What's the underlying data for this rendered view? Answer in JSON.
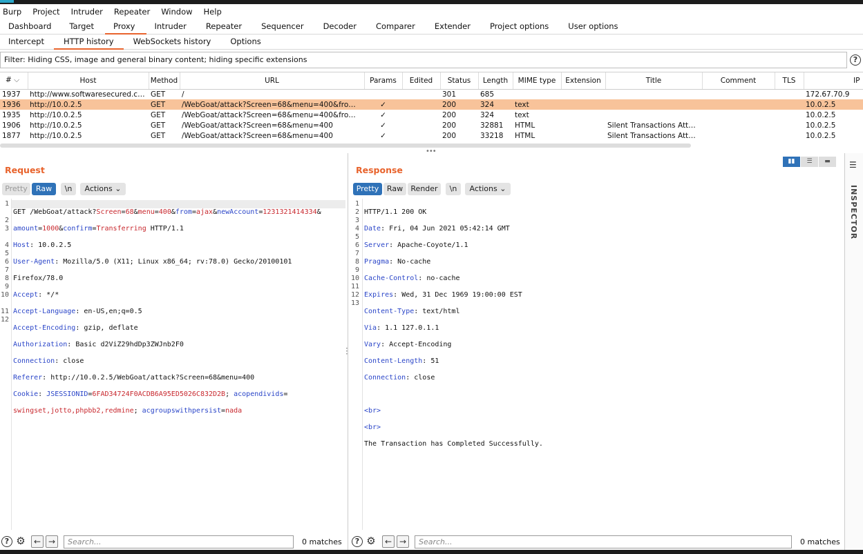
{
  "menubar": [
    "Burp",
    "Project",
    "Intruder",
    "Repeater",
    "Window",
    "Help"
  ],
  "main_tabs": [
    "Dashboard",
    "Target",
    "Proxy",
    "Intruder",
    "Repeater",
    "Sequencer",
    "Decoder",
    "Comparer",
    "Extender",
    "Project options",
    "User options"
  ],
  "main_tab_active": "Proxy",
  "sub_tabs": [
    "Intercept",
    "HTTP history",
    "WebSockets history",
    "Options"
  ],
  "sub_tab_active": "HTTP history",
  "filter_text": "Filter: Hiding CSS, image and general binary content;  hiding specific extensions",
  "help_label": "?",
  "table": {
    "columns": [
      "#",
      "Host",
      "Method",
      "URL",
      "Params",
      "Edited",
      "Status",
      "Length",
      "MIME type",
      "Extension",
      "Title",
      "Comment",
      "TLS",
      "IP"
    ],
    "rows": [
      {
        "num": "1937",
        "host": "http://www.softwaresecured.com",
        "method": "GET",
        "url": "/",
        "params": "",
        "edited": "",
        "status": "301",
        "length": "685",
        "mime": "",
        "ext": "",
        "title": "",
        "comment": "",
        "tls": "",
        "ip": "172.67.70.9",
        "selected": false
      },
      {
        "num": "1936",
        "host": "http://10.0.2.5",
        "method": "GET",
        "url": "/WebGoat/attack?Screen=68&menu=400&from=...",
        "params": "✓",
        "edited": "",
        "status": "200",
        "length": "324",
        "mime": "text",
        "ext": "",
        "title": "",
        "comment": "",
        "tls": "",
        "ip": "10.0.2.5",
        "selected": true
      },
      {
        "num": "1935",
        "host": "http://10.0.2.5",
        "method": "GET",
        "url": "/WebGoat/attack?Screen=68&menu=400&from=...",
        "params": "✓",
        "edited": "",
        "status": "200",
        "length": "324",
        "mime": "text",
        "ext": "",
        "title": "",
        "comment": "",
        "tls": "",
        "ip": "10.0.2.5",
        "selected": false
      },
      {
        "num": "1906",
        "host": "http://10.0.2.5",
        "method": "GET",
        "url": "/WebGoat/attack?Screen=68&menu=400",
        "params": "✓",
        "edited": "",
        "status": "200",
        "length": "32881",
        "mime": "HTML",
        "ext": "",
        "title": "Silent Transactions Attacks",
        "comment": "",
        "tls": "",
        "ip": "10.0.2.5",
        "selected": false
      },
      {
        "num": "1877",
        "host": "http://10.0.2.5",
        "method": "GET",
        "url": "/WebGoat/attack?Screen=68&menu=400",
        "params": "✓",
        "edited": "",
        "status": "200",
        "length": "33218",
        "mime": "HTML",
        "ext": "",
        "title": "Silent Transactions Attacks",
        "comment": "",
        "tls": "",
        "ip": "10.0.2.5",
        "selected": false
      }
    ]
  },
  "request": {
    "title": "Request",
    "buttons": {
      "pretty": "Pretty",
      "raw": "Raw",
      "newline": "\\n",
      "actions": "Actions"
    },
    "line_numbers": [
      "1",
      "",
      "2",
      "3",
      "",
      "4",
      "5",
      "6",
      "7",
      "8",
      "9",
      "10",
      "",
      "11",
      "12"
    ],
    "lines": {
      "l1": [
        "GET /WebGoat/attack?",
        "Screen",
        "=",
        "68",
        "&",
        "menu",
        "=",
        "400",
        "&",
        "from",
        "=",
        "ajax",
        "&",
        "newAccount",
        "=",
        "1231321414334",
        "&"
      ],
      "l1b": [
        "amount",
        "=",
        "1000",
        "&",
        "confirm",
        "=",
        "Transferring",
        " HTTP/1.1"
      ],
      "l2": [
        "Host",
        ": 10.0.2.5"
      ],
      "l3": [
        "User-Agent",
        ": Mozilla/5.0 (X11; Linux x86_64; rv:78.0) Gecko/20100101"
      ],
      "l3b": "Firefox/78.0",
      "l4": [
        "Accept",
        ": */*"
      ],
      "l5": [
        "Accept-Language",
        ": en-US,en;q=0.5"
      ],
      "l6": [
        "Accept-Encoding",
        ": gzip, deflate"
      ],
      "l7": [
        "Authorization",
        ": Basic d2ViZ29hdDp3ZWJnb2F0"
      ],
      "l8": [
        "Connection",
        ": close"
      ],
      "l9": [
        "Referer",
        ": http://10.0.2.5/WebGoat/attack?Screen=68&menu=400"
      ],
      "l10": [
        "Cookie",
        ": ",
        "JSESSIONID",
        "=",
        "6FAD34724F0ACDB6A95ED5026C832D2B",
        "; ",
        "acopendivids",
        "="
      ],
      "l10b": [
        "swingset,jotto,phpbb2,redmine",
        "; ",
        "acgroupswithpersist",
        "=",
        "nada"
      ]
    },
    "search_placeholder": "Search...",
    "matches": "0 matches"
  },
  "response": {
    "title": "Response",
    "buttons": {
      "pretty": "Pretty",
      "raw": "Raw",
      "render": "Render",
      "newline": "\\n",
      "actions": "Actions"
    },
    "line_numbers": [
      "1",
      "2",
      "3",
      "4",
      "5",
      "6",
      "7",
      "8",
      "9",
      "10",
      "11",
      "12",
      "13",
      "",
      ""
    ],
    "lines": {
      "l1": "HTTP/1.1 200 OK",
      "l2": [
        "Date",
        ": Fri, 04 Jun 2021 05:42:14 GMT"
      ],
      "l3": [
        "Server",
        ": Apache-Coyote/1.1"
      ],
      "l4": [
        "Pragma",
        ": No-cache"
      ],
      "l5": [
        "Cache-Control",
        ": no-cache"
      ],
      "l6": [
        "Expires",
        ": Wed, 31 Dec 1969 19:00:00 EST"
      ],
      "l7": [
        "Content-Type",
        ": text/html"
      ],
      "l8": [
        "Via",
        ": 1.1 127.0.1.1"
      ],
      "l9": [
        "Vary",
        ": Accept-Encoding"
      ],
      "l10": [
        "Content-Length",
        ": 51"
      ],
      "l11": [
        "Connection",
        ": close"
      ],
      "l13": "<br>",
      "l13b": "<br>",
      "l13c": "The Transaction has Completed Successfully."
    },
    "search_placeholder": "Search...",
    "matches": "0 matches"
  },
  "inspector_label": "INSPECTOR",
  "colors": {
    "accent": "#e8632c",
    "selected_row": "#f8c39a",
    "active_button": "#2f72b8",
    "key": "#2a45c8",
    "value": "#c8282e"
  }
}
